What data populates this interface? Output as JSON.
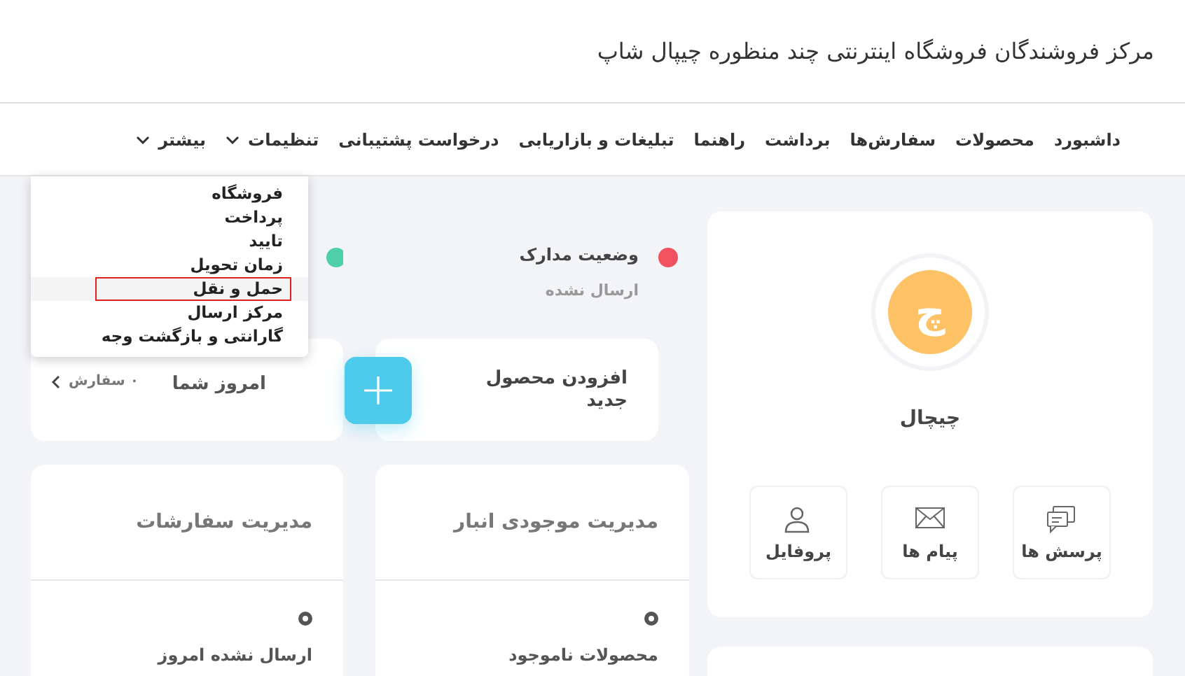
{
  "header": {
    "title": "مرکز فروشندگان فروشگاه اینترنتی چند منظوره چیپال شاپ"
  },
  "nav": [
    {
      "label": "داشبورد",
      "kind": "link"
    },
    {
      "label": "محصولات",
      "kind": "link"
    },
    {
      "label": "سفارش‌ها",
      "kind": "link"
    },
    {
      "label": "برداشت",
      "kind": "link"
    },
    {
      "label": "راهنما",
      "kind": "link"
    },
    {
      "label": "تبلیغات و بازاریابی",
      "kind": "link"
    },
    {
      "label": "درخواست پشتیبانی",
      "kind": "link"
    },
    {
      "label": "تنظیمات",
      "kind": "menu"
    },
    {
      "label": "بیشتر",
      "kind": "menu"
    }
  ],
  "dropdown": {
    "items": [
      {
        "label": "فروشگاه",
        "selected": false
      },
      {
        "label": "پرداخت",
        "selected": false
      },
      {
        "label": "تایید",
        "selected": false
      },
      {
        "label": "زمان تحویل",
        "selected": false
      },
      {
        "label": "حمل و نقل",
        "selected": true
      },
      {
        "label": "مرکز ارسال",
        "selected": false
      },
      {
        "label": "گارانتی و بازگشت وجه",
        "selected": false
      }
    ]
  },
  "profile": {
    "avatar_letter": "چ",
    "name": "چیچال",
    "actions": [
      {
        "label": "پرسش ها",
        "kind": "chat"
      },
      {
        "label": "پیام ها",
        "kind": "mail"
      },
      {
        "label": "پروفایل",
        "kind": "user"
      }
    ]
  },
  "statuses": [
    {
      "label": "وضعیت مدارک",
      "value": "ارسال نشده",
      "color": "#f0525f"
    },
    {
      "color": "#4fcfa6"
    }
  ],
  "add_product": {
    "label": "افزودن محصول جدید"
  },
  "today_orders": {
    "label": "امروز شما",
    "count": "۰ سفارش"
  },
  "panels": [
    {
      "title": "مدیریت موجودی انبار",
      "item": "محصولات ناموجود"
    },
    {
      "title": "مدیریت سفارشات",
      "item": "ارسال نشده امروز"
    }
  ]
}
